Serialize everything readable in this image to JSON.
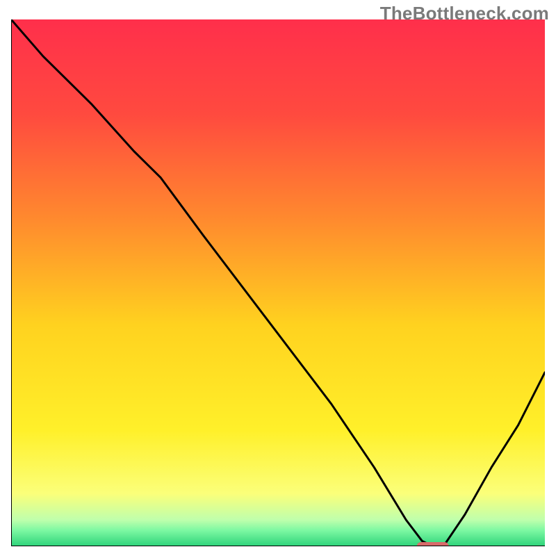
{
  "watermark": "TheBottleneck.com",
  "chart_data": {
    "type": "line",
    "title": "",
    "xlabel": "",
    "ylabel": "",
    "xlim": [
      0,
      100
    ],
    "ylim": [
      0,
      100
    ],
    "grid": false,
    "legend": false,
    "gradient_stops": [
      {
        "offset": 0.0,
        "color": "#ff2f4b"
      },
      {
        "offset": 0.18,
        "color": "#ff4a3f"
      },
      {
        "offset": 0.38,
        "color": "#ff8a2e"
      },
      {
        "offset": 0.58,
        "color": "#ffd21f"
      },
      {
        "offset": 0.78,
        "color": "#fff02a"
      },
      {
        "offset": 0.9,
        "color": "#fbff7a"
      },
      {
        "offset": 0.95,
        "color": "#bfffac"
      },
      {
        "offset": 0.97,
        "color": "#7cf8a2"
      },
      {
        "offset": 1.0,
        "color": "#2dd37a"
      }
    ],
    "series": [
      {
        "name": "bottleneck-curve",
        "color": "#000000",
        "width": 3,
        "x": [
          0,
          6,
          15,
          23,
          25,
          28,
          36,
          48,
          60,
          68,
          74,
          77,
          79,
          81,
          85,
          90,
          95,
          100
        ],
        "y": [
          100,
          93,
          84,
          75,
          73,
          70,
          59,
          43,
          27,
          15,
          5,
          1,
          0,
          0,
          6,
          15,
          23,
          33
        ]
      }
    ],
    "marker": {
      "name": "optimal-point",
      "x": 79,
      "y": 0,
      "width_pct": 6.0,
      "height_pct": 1.6,
      "color": "#d86a6a"
    }
  }
}
